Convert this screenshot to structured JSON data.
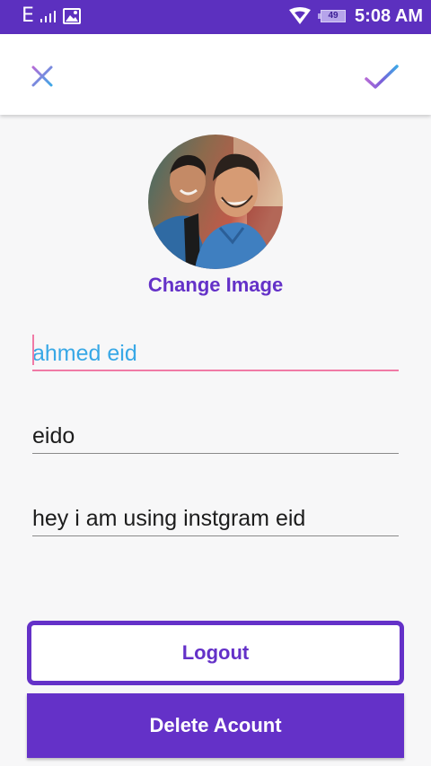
{
  "status_bar": {
    "network_label": "E",
    "battery_level": "49",
    "time": "5:08 AM",
    "icons": [
      "signal-icon",
      "image-notification-icon",
      "wifi-icon",
      "battery-icon"
    ]
  },
  "toolbar": {
    "close_icon": "close-icon",
    "confirm_icon": "check-icon"
  },
  "profile": {
    "change_image_label": "Change Image"
  },
  "form": {
    "name_value": "ahmed eid",
    "username_value": "eido",
    "bio_value": "hey i am using instgram eid"
  },
  "actions": {
    "logout_label": "Logout",
    "delete_label": "Delete Acount"
  },
  "colors": {
    "primary": "#6431c8",
    "status_bar": "#5c30bf",
    "focused_text": "#38a8e6",
    "focused_underline": "#f07aa6",
    "background": "#f7f7f8"
  }
}
